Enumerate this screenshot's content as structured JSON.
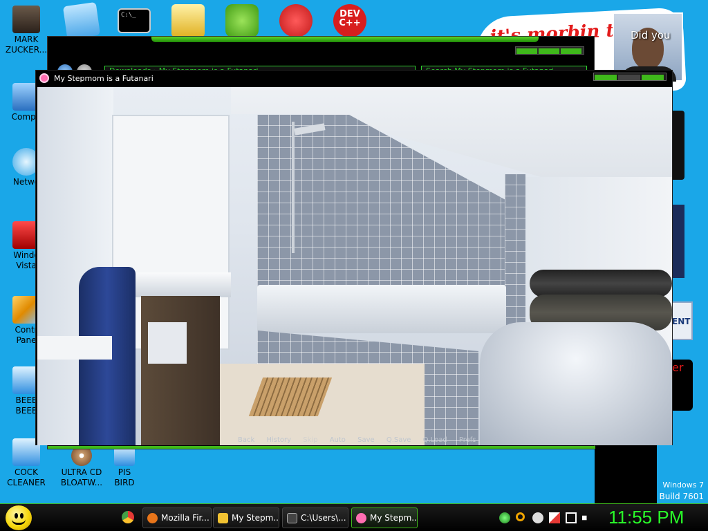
{
  "desktop": {
    "icons": [
      {
        "label": "MARK\nZUCKER..."
      },
      {
        "label": "Compu"
      },
      {
        "label": "Netwo"
      },
      {
        "label": "Windo\nVista"
      },
      {
        "label": "Contr\nPane"
      },
      {
        "label": "BEEE\nBEEE"
      },
      {
        "label": "COCK\nCLEANER"
      },
      {
        "label": "ULTRA CD\nBLOATW..."
      },
      {
        "label": "PIS\nBIRD"
      }
    ],
    "top_icons": [
      "notes-icon",
      "cmd-icon",
      "folder-icon",
      "bad-piggies-icon",
      "picasa-icon",
      "dev-cpp-icon"
    ],
    "top_icon_text": {
      "cmd": "C:\\_",
      "dev": "DEV\nC++"
    }
  },
  "browser": {
    "url": "Downloads  ›  My Stepmom is a Futanari",
    "search": "Search My Stepmom is a Futanari"
  },
  "banner": {
    "text": "it's morbin t",
    "photo_caption": "Did you"
  },
  "right_fragments": {
    "ent": "ENT",
    "er": "er"
  },
  "game_window": {
    "title": "My Stepmom is a Futanari",
    "menu": [
      "Back",
      "History",
      "Skip",
      "Auto",
      "Save",
      "Q.Save",
      "Q.Load",
      "Prefs"
    ]
  },
  "watermark": {
    "line1": "Windows 7",
    "line2": "Build 7601"
  },
  "taskbar": {
    "buttons": [
      {
        "label": "Mozilla Fir...",
        "icon": "firefox-icon",
        "color": "#e8751a",
        "active": false
      },
      {
        "label": "My Stepm...",
        "icon": "folder-icon",
        "color": "#f1c232",
        "active": false
      },
      {
        "label": "C:\\Users\\...",
        "icon": "cmd-icon",
        "color": "#444444",
        "active": false
      },
      {
        "label": "My Stepm...",
        "icon": "renpy-icon",
        "color": "#ff6eb1",
        "active": true
      }
    ],
    "clock": "11:55 PM"
  },
  "colors": {
    "desktop_bg": "#1aa7e8",
    "accent_green": "#3fb81b",
    "clock_green": "#29ff29"
  }
}
